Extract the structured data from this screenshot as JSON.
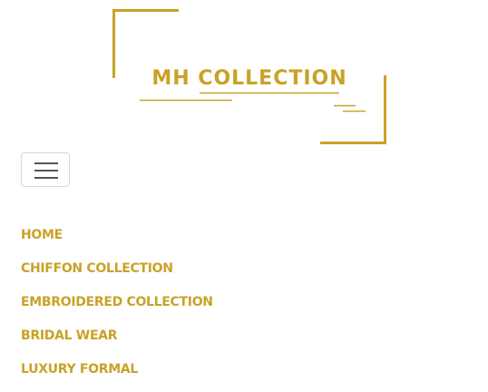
{
  "brand": {
    "logo_text": "MH COLLECTION",
    "color": "#c9a227"
  },
  "navbar": {
    "toggler_icon": "hamburger-menu-icon"
  },
  "menu": {
    "items": [
      {
        "label": "HOME"
      },
      {
        "label": "CHIFFON COLLECTION"
      },
      {
        "label": "EMBROIDERED COLLECTION"
      },
      {
        "label": "BRIDAL WEAR"
      },
      {
        "label": "LUXURY FORMAL"
      }
    ]
  }
}
